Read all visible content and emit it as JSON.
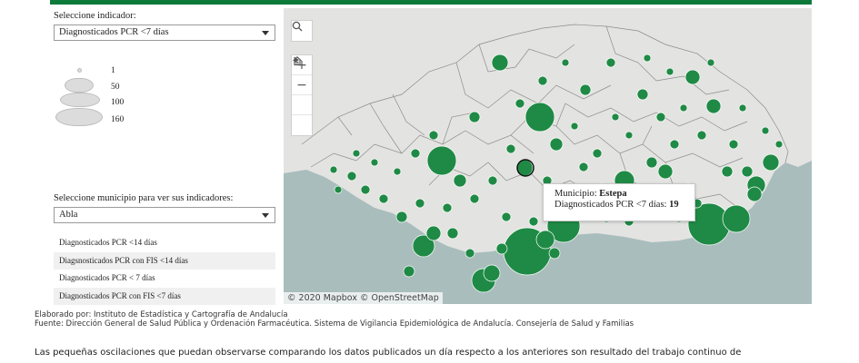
{
  "indicator": {
    "label": "Seleccione indicador:",
    "selected": "Diagnosticados PCR <7 días"
  },
  "legend": {
    "items": [
      "1",
      "50",
      "100",
      "160"
    ]
  },
  "municipio": {
    "label": "Seleccione municipio para ver sus indicadores:",
    "selected": "Abla"
  },
  "indicator_list": [
    "Diagnosticados PCR <14 días",
    "Diagsnosticados PCR con FIS <14 días",
    "Diagnosticados PCR < 7 días",
    "Diagnosticados PCR con FIS <7 días"
  ],
  "map": {
    "attribution": "© 2020 Mapbox © OpenStreetMap",
    "bubble_color": "#1f8a45",
    "land_color": "#e3e3e1",
    "sea_color": "#a9bdbd",
    "controls": [
      "search-icon",
      "zoom-in-icon",
      "zoom-out-icon",
      "home-icon",
      "play-icon"
    ]
  },
  "tooltip": {
    "municipio_label": "Municipio:",
    "municipio_value": "Estepa",
    "indicator_label": "Diagnosticados PCR <7 días:",
    "indicator_value": "19"
  },
  "credits": {
    "line1": "Elaborado por: Instituto de Estadística y Cartografía de Andalucía",
    "line2": "Fuente: Dirección General de Salud Pública y Ordenación Farmacéutica. Sistema de Vigilancia Epidemiológica de Andalucía. Consejería de Salud y Familias"
  },
  "note": "Las pequeñas oscilaciones que puedan observarse comparando los datos publicados un día respecto a los anteriores son resultado del trabajo continuo de"
}
